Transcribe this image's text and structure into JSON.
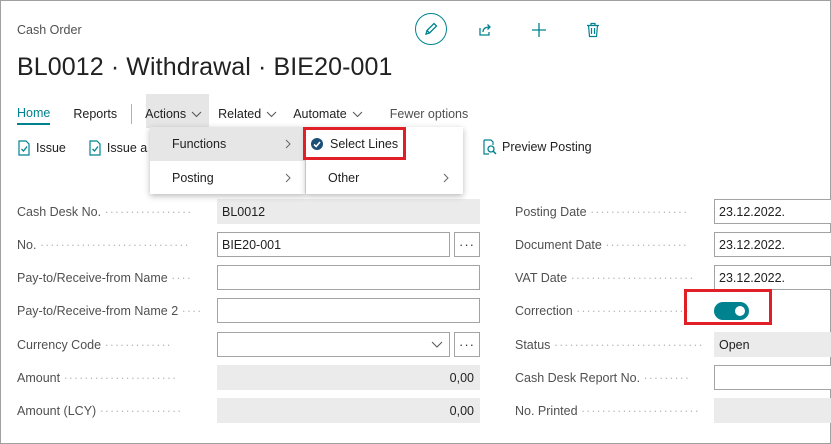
{
  "page": {
    "type": "Cash Order",
    "title": "BL0012 · Withdrawal · BIE20-001"
  },
  "top_icons": [
    "pencil-icon",
    "share-icon",
    "plus-icon",
    "trash-icon"
  ],
  "tabs": [
    "Home",
    "Reports",
    "Actions",
    "Related",
    "Automate",
    "Fewer options"
  ],
  "actions_bar": {
    "issue": "Issue",
    "issue_and": "Issue a",
    "preview_posting": "Preview Posting"
  },
  "menus": {
    "actions": [
      "Functions",
      "Posting"
    ],
    "functions": [
      "Select Lines",
      "Other"
    ]
  },
  "left_fields": [
    {
      "label": "Cash Desk No.",
      "value": "BL0012"
    },
    {
      "label": "No.",
      "value": "BIE20-001"
    },
    {
      "label": "Pay-to/Receive-from Name",
      "value": ""
    },
    {
      "label": "Pay-to/Receive-from Name 2",
      "value": ""
    },
    {
      "label": "Currency Code",
      "value": ""
    },
    {
      "label": "Amount",
      "value": "0,00"
    },
    {
      "label": "Amount (LCY)",
      "value": "0,00"
    }
  ],
  "right_fields": [
    {
      "label": "Posting Date",
      "value": "23.12.2022."
    },
    {
      "label": "Document Date",
      "value": "23.12.2022."
    },
    {
      "label": "VAT Date",
      "value": "23.12.2022."
    },
    {
      "label": "Correction",
      "value": "on"
    },
    {
      "label": "Status",
      "value": "Open"
    },
    {
      "label": "Cash Desk Report No.",
      "value": ""
    },
    {
      "label": "No. Printed",
      "value": ""
    }
  ],
  "colors": {
    "accent": "#00838f",
    "highlight": "#e11f26",
    "readonly_bg": "#ebebeb"
  }
}
